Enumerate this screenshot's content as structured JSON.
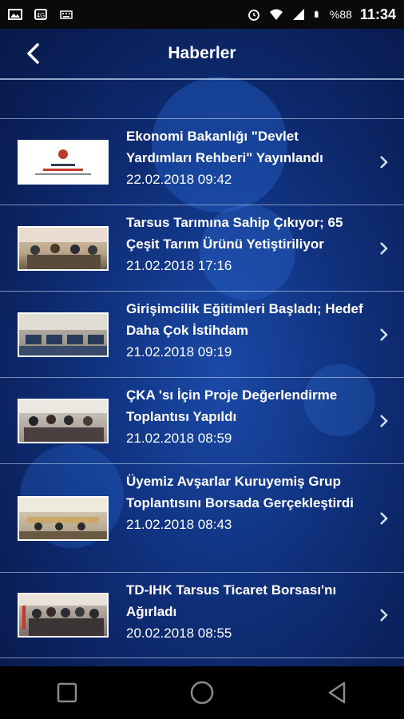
{
  "status_bar": {
    "battery": "%88",
    "time": "11:34",
    "icons": [
      "image-icon",
      "signal-boost-icon",
      "keyboard-icon",
      "alarm-icon",
      "wifi-icon",
      "cell-signal-icon",
      "battery-icon"
    ]
  },
  "header": {
    "title": "Haberler",
    "back_icon": "back-chevron-icon"
  },
  "news": [
    {
      "title": "Ekonomi Bakanlığı \"Devlet Yardımları Rehberi\" Yayınlandı",
      "date": "22.02.2018 09:42"
    },
    {
      "title": "Tarsus Tarımına Sahip Çıkıyor; 65 Çeşit Tarım Ürünü Yetiştiriliyor",
      "date": "21.02.2018 17:16"
    },
    {
      "title": "Girişimcilik Eğitimleri Başladı; Hedef Daha Çok İstihdam",
      "date": "21.02.2018 09:19"
    },
    {
      "title": "ÇKA 'sı İçin Proje Değerlendirme Toplantısı Yapıldı",
      "date": "21.02.2018 08:59"
    },
    {
      "title": "Üyemiz Avşarlar Kuruyemiş Grup Toplantısını Borsada Gerçekleştirdi",
      "date": "21.02.2018 08:43"
    },
    {
      "title": "TD-IHK Tarsus Ticaret Borsası'nı Ağırladı",
      "date": "20.02.2018 08:55"
    }
  ],
  "colors": {
    "accent_bg": "#0f2f7a",
    "divider": "#c8d7f5",
    "text": "#ffffff"
  },
  "navbar": {
    "icons": [
      "recent-apps-icon",
      "home-icon",
      "back-icon"
    ]
  }
}
